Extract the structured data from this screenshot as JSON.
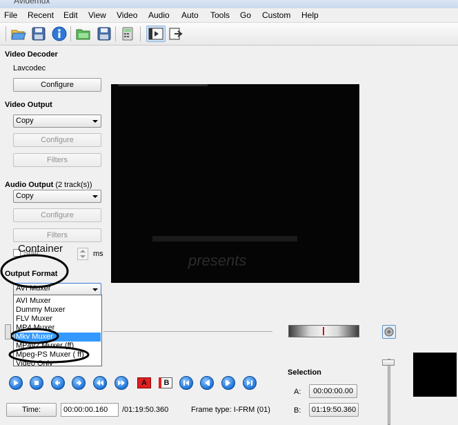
{
  "window": {
    "title": "Avidemux"
  },
  "menu": [
    "File",
    "Recent",
    "Edit",
    "View",
    "Video",
    "Audio",
    "Auto",
    "Tools",
    "Go",
    "Custom",
    "Help"
  ],
  "toolbar": {
    "icons": [
      "open-folder-icon",
      "save-icon",
      "info-icon",
      "open-green-icon",
      "save-video-icon",
      "calculator-icon",
      "video-filter-icon",
      "export-icon"
    ]
  },
  "video_decoder": {
    "label": "Video Decoder",
    "codec": "Lavcodec",
    "configure": "Configure"
  },
  "video_output": {
    "label": "Video Output",
    "selected": "Copy",
    "configure": "Configure",
    "filters": "Filters"
  },
  "audio_output": {
    "label": "Audio Output",
    "tracks": "(2 track(s))",
    "selected": "Copy",
    "configure": "Configure",
    "filters": "Filters",
    "shift_label": "Shift:",
    "shift_unit": "ms"
  },
  "annotation": {
    "container": "Container"
  },
  "output_format": {
    "label": "Output Format",
    "selected": "AVI Muxer",
    "options": [
      "AVI Muxer",
      "Dummy Muxer",
      "FLV Muxer",
      "MP4 Muxer",
      "Mkv Muxer",
      "MP4v2 Muxer (ff)",
      "Mpeg-PS Muxer ( ff)",
      "Video Only"
    ],
    "highlighted_index": 4
  },
  "video_overlay_text": "presents",
  "transport": {
    "buttons": [
      "play-icon",
      "stop-icon",
      "prev-frame-icon",
      "next-frame-icon",
      "rewind-icon",
      "forward-icon",
      "marker-a-icon",
      "marker-b-icon",
      "goto-start-icon",
      "prev-keyframe-icon",
      "next-keyframe-icon",
      "goto-end-icon"
    ],
    "marker_a": "A",
    "marker_b": "B"
  },
  "status": {
    "time_button": "Time:",
    "current_time": "00:00:00.160",
    "total_time": "/01:19:50.360",
    "frame_type": "Frame type:  I-FRM (01)"
  },
  "selection": {
    "label": "Selection",
    "a_label": "A:",
    "a_value": "00:00:00.00",
    "b_label": "B:",
    "b_value": "01:19:50.360"
  },
  "colors": {
    "accent": "#3399ff",
    "annotation": "#000000"
  }
}
